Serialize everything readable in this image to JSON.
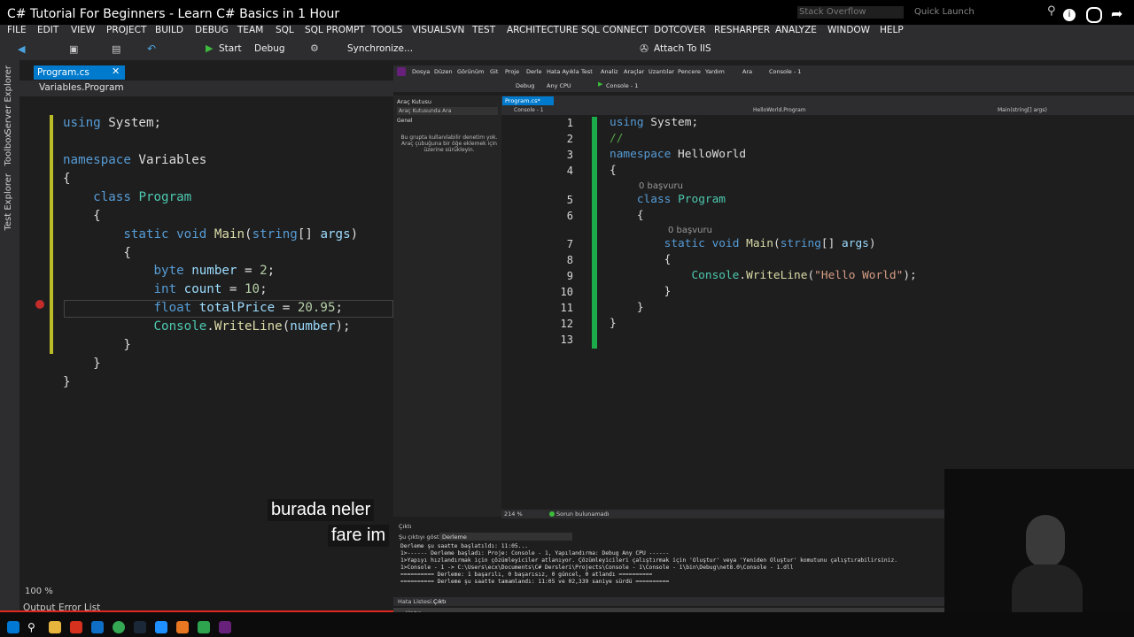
{
  "window": {
    "title": "C# Tutorial For Beginners - Learn C# Basics in 1 Hour"
  },
  "header": {
    "search_placeholder": "Stack Overflow",
    "quick_launch": "Quick Launch"
  },
  "menu": [
    "FILE",
    "EDIT",
    "VIEW",
    "PROJECT",
    "BUILD",
    "DEBUG",
    "TEAM",
    "SQL",
    "SQL PROMPT",
    "TOOLS",
    "VISUALSVN",
    "TEST",
    "ARCHITECTURE",
    "SQL CONNECT",
    "DOTCOVER",
    "RESHARPER",
    "ANALYZE",
    "WINDOW",
    "HELP"
  ],
  "toolbar": {
    "start": "Start",
    "config": "Debug",
    "sync": "Synchronize...",
    "attach": "Attach To IIS"
  },
  "side_panels": [
    "Server Explorer",
    "Toolbox",
    "Test Explorer"
  ],
  "doc_tab": "Program.cs",
  "breadcrumb": "Variables.Program",
  "zoom": "100 %",
  "bottom_tabs": [
    "Output",
    "Error List"
  ],
  "code1": [
    [
      [
        "kw",
        "using"
      ],
      [
        "pl",
        " System;"
      ]
    ],
    [],
    [
      [
        "kw",
        "namespace"
      ],
      [
        "pl",
        " Variables"
      ]
    ],
    [
      [
        "pl",
        "{"
      ]
    ],
    [
      [
        "pl",
        "    "
      ],
      [
        "kw",
        "class"
      ],
      [
        "pl",
        " "
      ],
      [
        "ty",
        "Program"
      ]
    ],
    [
      [
        "pl",
        "    {"
      ]
    ],
    [
      [
        "pl",
        "        "
      ],
      [
        "kw",
        "static"
      ],
      [
        "pl",
        " "
      ],
      [
        "kw",
        "void"
      ],
      [
        "pl",
        " "
      ],
      [
        "mt",
        "Main"
      ],
      [
        "pl",
        "("
      ],
      [
        "kw",
        "string"
      ],
      [
        "pl",
        "[] "
      ],
      [
        "vr",
        "args"
      ],
      [
        "pl",
        ")"
      ]
    ],
    [
      [
        "pl",
        "        {"
      ]
    ],
    [
      [
        "pl",
        "            "
      ],
      [
        "kw",
        "byte"
      ],
      [
        "pl",
        " "
      ],
      [
        "vr",
        "number"
      ],
      [
        "pl",
        " = "
      ],
      [
        "nm",
        "2"
      ],
      [
        "pl",
        ";"
      ]
    ],
    [
      [
        "pl",
        "            "
      ],
      [
        "kw",
        "int"
      ],
      [
        "pl",
        " "
      ],
      [
        "vr",
        "count"
      ],
      [
        "pl",
        " = "
      ],
      [
        "nm",
        "10"
      ],
      [
        "pl",
        ";"
      ]
    ],
    [
      [
        "pl",
        "            "
      ],
      [
        "kw",
        "float"
      ],
      [
        "pl",
        " "
      ],
      [
        "vr",
        "totalPrice"
      ],
      [
        "pl",
        " = "
      ],
      [
        "nm",
        "20.95"
      ],
      [
        "pl",
        ";"
      ]
    ],
    [
      [
        "pl",
        "            "
      ],
      [
        "ty",
        "Console"
      ],
      [
        "pl",
        "."
      ],
      [
        "mt",
        "WriteLine"
      ],
      [
        "pl",
        "("
      ],
      [
        "vr",
        "number"
      ],
      [
        "pl",
        ");"
      ]
    ],
    [
      [
        "pl",
        "        }"
      ]
    ],
    [
      [
        "pl",
        "    }"
      ]
    ],
    [
      [
        "pl",
        "}"
      ]
    ]
  ],
  "inner": {
    "menu": [
      "Dosya",
      "Düzen",
      "Görünüm",
      "Git",
      "Proje",
      "Derle",
      "Hata Ayıkla",
      "Test",
      "Analiz",
      "Araçlar",
      "Uzantılar",
      "Pencere",
      "Yardım",
      "Ara",
      "Console - 1"
    ],
    "toolbar": {
      "config": "Debug",
      "platform": "Any CPU",
      "run": "Console - 1"
    },
    "toolbox_title": "Araç Kutusu",
    "toolbox_search": "Araç Kutusunda Ara",
    "toolbox_group": "Genel",
    "toolbox_msg": "Bu grupta kullanılabilir denetim yok. Araç çubuğuna bir öğe eklemek için üzerine sürükleyin.",
    "tab": "Program.cs*",
    "nav": [
      "Console - 1",
      "HelloWorld.Program",
      "Main(string[] args)"
    ],
    "line_numbers": [
      "1",
      "2",
      "3",
      "4",
      "5",
      "6",
      "7",
      "8",
      "9",
      "10",
      "11",
      "12",
      "13"
    ],
    "refs": [
      "0 başvuru",
      "0 başvuru"
    ],
    "code": [
      [
        [
          "kw",
          "using"
        ],
        [
          "pl",
          " System;"
        ]
      ],
      [
        [
          "cm",
          "//"
        ]
      ],
      [
        [
          "kw",
          "namespace"
        ],
        [
          "pl",
          " HelloWorld"
        ]
      ],
      [
        [
          "pl",
          "{"
        ]
      ],
      [
        [
          "pl",
          "    "
        ],
        [
          "kw",
          "class"
        ],
        [
          "pl",
          " "
        ],
        [
          "ty",
          "Program"
        ]
      ],
      [
        [
          "pl",
          "    {"
        ]
      ],
      [
        [
          "pl",
          "        "
        ],
        [
          "kw",
          "static"
        ],
        [
          "pl",
          " "
        ],
        [
          "kw",
          "void"
        ],
        [
          "pl",
          " "
        ],
        [
          "mt",
          "Main"
        ],
        [
          "pl",
          "("
        ],
        [
          "kw",
          "string"
        ],
        [
          "pl",
          "[] "
        ],
        [
          "vr",
          "args"
        ],
        [
          "pl",
          ")"
        ]
      ],
      [
        [
          "pl",
          "        {"
        ]
      ],
      [
        [
          "pl",
          "            "
        ],
        [
          "ty",
          "Console"
        ],
        [
          "pl",
          "."
        ],
        [
          "mt",
          "WriteLine"
        ],
        [
          "pl",
          "("
        ],
        [
          "st",
          "\"Hello World\""
        ],
        [
          "pl",
          ");"
        ]
      ],
      [
        [
          "pl",
          "        }"
        ]
      ],
      [
        [
          "pl",
          "    }"
        ]
      ],
      [
        [
          "pl",
          "}"
        ]
      ],
      []
    ],
    "status_zoom": "214 %",
    "status_msg": "Sorun bulunamadı",
    "output_title": "Çıktı",
    "output_source_label": "Şu çıktıyı göster:",
    "output_source": "Derleme",
    "output_lines": [
      "Derleme şu saatte başlatıldı: 11:05...",
      "1>------ Derleme başladı: Proje: Console - 1, Yapılandırma: Debug Any CPU ------",
      "1>Yapıyı hızlandırmak için çözümleyiciler atlanıyor. Çözümleyicileri çalıştırmak için 'Oluştur' veya 'Yeniden Oluştur' komutunu çalıştırabilirsiniz.",
      "1>Console - 1 -> C:\\Users\\ecx\\Documents\\C# Dersleri\\Projects\\Console - 1\\Console - 1\\bin\\Debug\\net8.0\\Console - 1.dll",
      "========== Derleme: 1 başarılı, 0 başarısız, 0 güncel, 0 atlandı ==========",
      "========== Derleme şu saatte tamamlandı: 11:05 ve 02,339 saniye sürdü =========="
    ],
    "bottom_tabs": [
      "Hata Listesi...",
      "Çıktı"
    ],
    "status": "Hazır"
  },
  "subtitles": [
    "burada neler",
    "fare im"
  ]
}
